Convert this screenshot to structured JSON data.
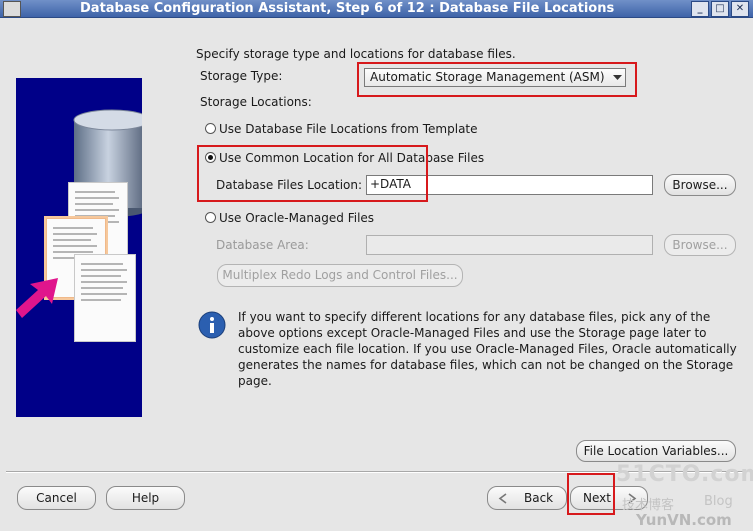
{
  "window": {
    "title": "Database Configuration Assistant, Step 6 of 12 : Database File Locations",
    "min_symbol": "_",
    "max_symbol": "□",
    "close_symbol": "✕"
  },
  "intro": "Specify storage type and locations for database files.",
  "storage_type": {
    "label": "Storage Type:",
    "value": "Automatic Storage Management (ASM)"
  },
  "storage_locations_label": "Storage Locations:",
  "options": {
    "template": {
      "label": "Use Database File Locations from Template",
      "selected": false
    },
    "common": {
      "label": "Use Common Location for All Database Files",
      "selected": true,
      "field_label": "Database Files Location:",
      "field_value": "+DATA",
      "browse": "Browse..."
    },
    "omf": {
      "label": "Use Oracle-Managed Files",
      "selected": false,
      "field_label": "Database Area:",
      "field_value": "",
      "browse": "Browse...",
      "multiplex": "Multiplex Redo Logs and Control Files..."
    }
  },
  "info_text": "If you want to specify different locations for any database files, pick any of the above options except Oracle-Managed Files and use the Storage page later to customize each file location. If you use Oracle-Managed Files, Oracle automatically generates the names for database files, which can not be changed on the Storage page.",
  "file_location_variables": "File Location Variables...",
  "buttons": {
    "cancel": "Cancel",
    "help": "Help",
    "back": "Back",
    "next": "Next"
  },
  "watermark": {
    "site": "51CTO.com",
    "cn": "技术博客",
    "blog": "Blog",
    "yunvn": "YunVN.com"
  },
  "colors": {
    "titlebar": "#3e63a8",
    "panel": "#000088",
    "highlight": "#d7191c",
    "info": "#2b5fb0"
  }
}
